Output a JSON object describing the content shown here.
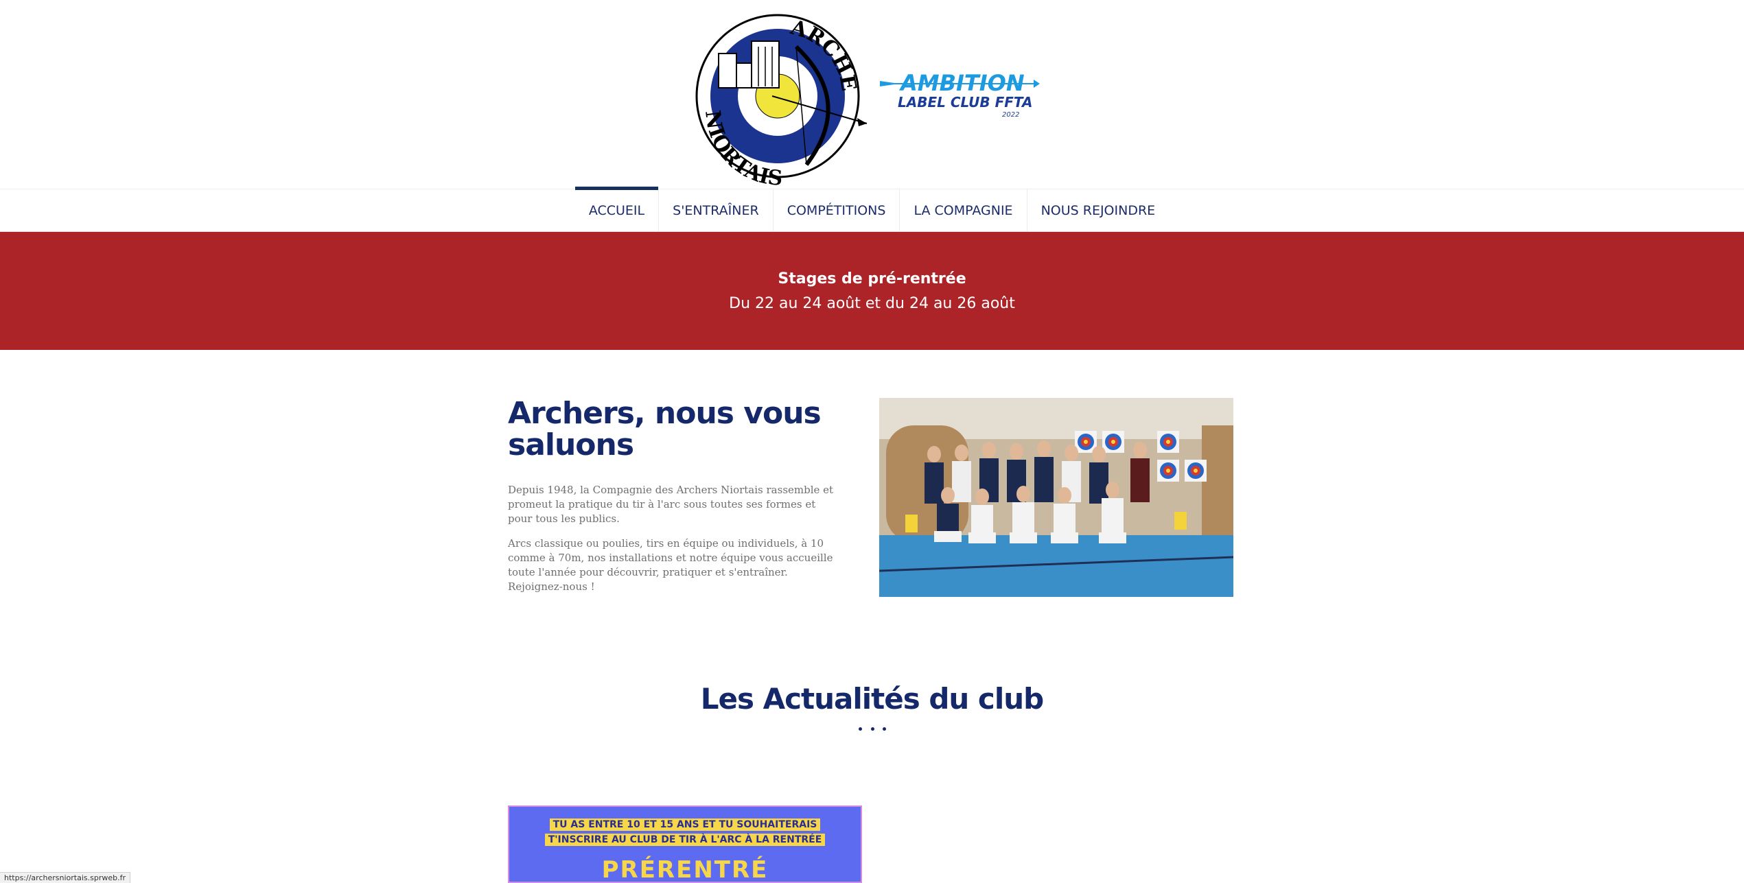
{
  "header": {
    "logo_text_top": "ARCHERS",
    "logo_text_bottom": "NIORTAIS",
    "ambition_line1": "AMBITION",
    "ambition_line2": "LABEL CLUB FFTA",
    "ambition_year": "2022"
  },
  "nav": {
    "items": [
      {
        "label": "ACCUEIL",
        "active": true
      },
      {
        "label": "S'ENTRAÎNER"
      },
      {
        "label": "COMPÉTITIONS"
      },
      {
        "label": "LA COMPAGNIE"
      },
      {
        "label": "NOUS REJOINDRE"
      }
    ]
  },
  "banner": {
    "title": "Stages de pré-rentrée",
    "subtitle": "Du 22 au 24 août et du 24 au 26 août"
  },
  "intro": {
    "title": "Archers, nous vous saluons",
    "p1": "Depuis 1948, la Compagnie des Archers Niortais rassemble et promeut la pratique du tir à l'arc sous toutes ses formes et pour tous les publics.",
    "p2": "Arcs classique ou poulies, tirs en équipe ou individuels, à 10 comme à 70m, nos installations et notre équipe vous accueille toute l'année pour découvrir, pratiquer et s'entraîner. Rejoignez-nous !"
  },
  "news": {
    "title": "Les Actualités du club",
    "card": {
      "line1": "TU AS ENTRE 10 ET 15 ANS ET TU SOUHAITERAIS",
      "line2": "T'INSCRIRE AU CLUB DE TIR À L'ARC À LA RENTRÉE",
      "headline": "PRÉRENTRÉ"
    }
  },
  "status": {
    "url": "https://archersniortais.sprweb.fr"
  },
  "colors": {
    "navy": "#14286a",
    "banner_red": "#ac2428",
    "ambition_blue": "#1e9be0"
  }
}
